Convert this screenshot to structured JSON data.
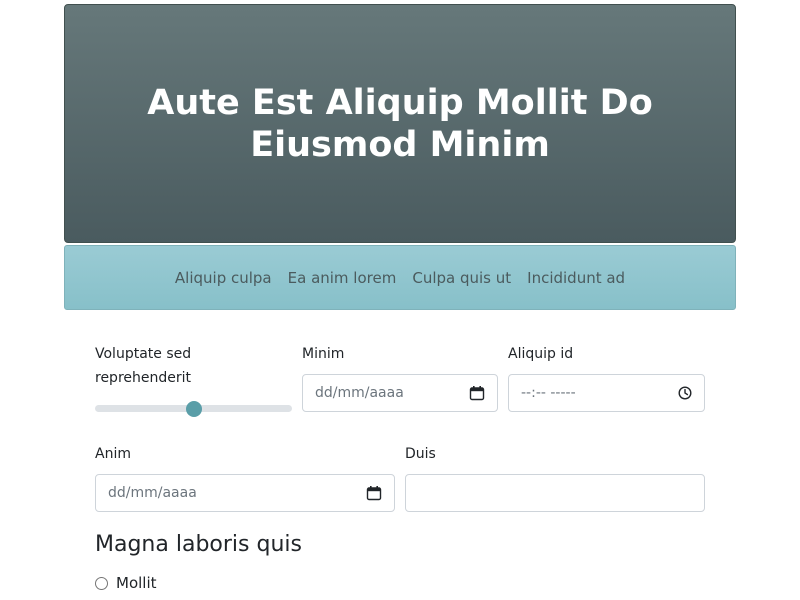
{
  "hero": {
    "title": "Aute Est Aliquip Mollit Do Eiusmod Minim"
  },
  "nav": {
    "links": [
      {
        "label": "Aliquip culpa"
      },
      {
        "label": "Ea anim lorem"
      },
      {
        "label": "Culpa quis ut"
      },
      {
        "label": "Incididunt ad"
      }
    ]
  },
  "form": {
    "range": {
      "label": "Voluptate sed reprehenderit",
      "value_fraction": 0.5
    },
    "minim": {
      "label": "Minim",
      "placeholder": "dd/mm/aaaa"
    },
    "aliquip_id": {
      "label": "Aliquip id",
      "placeholder": "--:-- -----"
    },
    "anim": {
      "label": "Anim",
      "placeholder": "dd/mm/aaaa"
    },
    "duis": {
      "label": "Duis",
      "value": ""
    }
  },
  "section": {
    "title": "Magna laboris quis",
    "options": [
      {
        "label": "Mollit"
      }
    ]
  },
  "icons": {
    "calendar": "calendar-icon",
    "clock": "clock-icon"
  },
  "colors": {
    "hero_top": "#66787a",
    "hero_bottom": "#4a5b5f",
    "nav_bg": "#92c6cf",
    "range_thumb": "#5a9ea8"
  }
}
